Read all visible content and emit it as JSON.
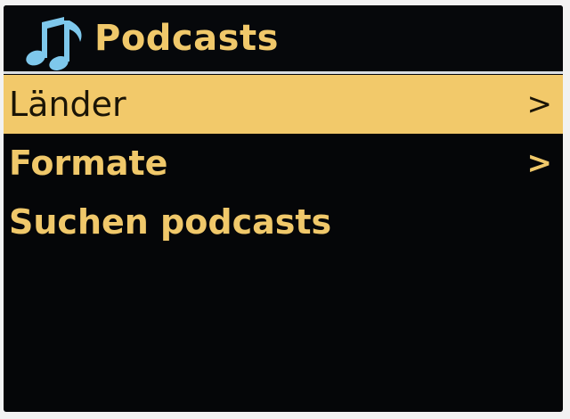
{
  "header": {
    "title": "Podcasts",
    "icon": "music-notes-icon"
  },
  "menu": {
    "items": [
      {
        "label": "Länder",
        "chevron": ">",
        "selected": true
      },
      {
        "label": "Formate",
        "chevron": ">",
        "selected": false
      },
      {
        "label": "Suchen podcasts",
        "selected": false
      }
    ]
  },
  "colors": {
    "background": "#050608",
    "text": "#f0c86a",
    "highlight": "#f2c96a",
    "icon": "#7ec8ec"
  }
}
